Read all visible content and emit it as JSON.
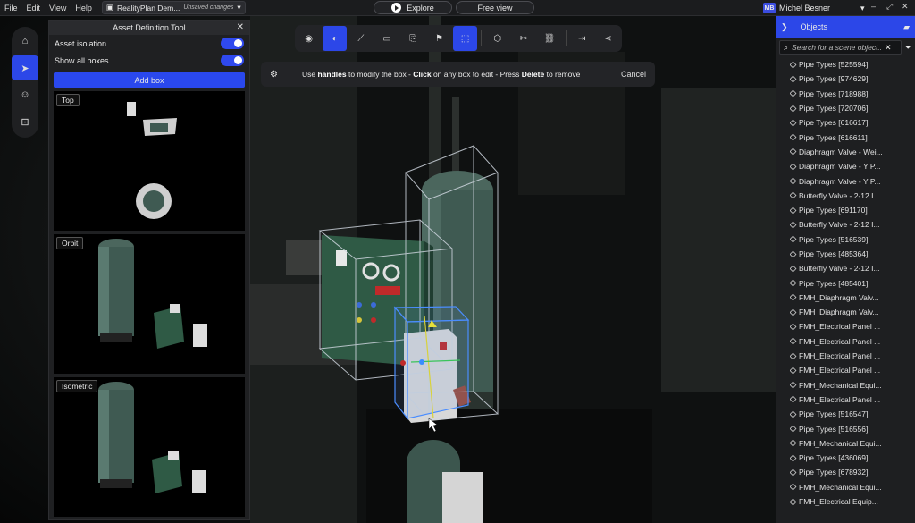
{
  "menubar": {
    "items": [
      "File",
      "Edit",
      "View",
      "Help"
    ],
    "doc_title": "RealityPlan Dem...",
    "doc_status": "Unsaved changes",
    "modes": [
      "Explore",
      "Free view"
    ],
    "user_initials": "MB",
    "user_name": "Michel Besner"
  },
  "asset_panel": {
    "title": "Asset Definition Tool",
    "asset_isolation": "Asset isolation",
    "show_all_boxes": "Show all boxes",
    "add_box": "Add box",
    "views": [
      "Top",
      "Orbit",
      "Isometric"
    ]
  },
  "hint": {
    "p1": "Use ",
    "b1": "handles",
    "p2": " to modify the box - ",
    "b2": "Click",
    "p3": " on any box to edit - Press ",
    "b3": "Delete",
    "p4": " to remove",
    "cancel": "Cancel"
  },
  "objects_panel": {
    "title": "Objects",
    "search_placeholder": "Search for a scene object...",
    "items": [
      "Pipe Types [525594]",
      "Pipe Types [974629]",
      "Pipe Types [718988]",
      "Pipe Types [720706]",
      "Pipe Types [616617]",
      "Pipe Types [616611]",
      "Diaphragm Valve - Wei...",
      "Diaphragm Valve - Y P...",
      "Diaphragm Valve - Y P...",
      "Butterfly Valve - 2-12 I...",
      "Pipe Types [691170]",
      "Butterfly Valve - 2-12 I...",
      "Pipe Types [516539]",
      "Pipe Types [485364]",
      "Butterfly Valve - 2-12 I...",
      "Pipe Types [485401]",
      "FMH_Diaphragm Valv...",
      "FMH_Diaphragm Valv...",
      "FMH_Electrical Panel ...",
      "FMH_Electrical Panel ...",
      "FMH_Electrical Panel ...",
      "FMH_Electrical Panel ...",
      "FMH_Mechanical Equi...",
      "FMH_Electrical Panel ...",
      "Pipe Types [516547]",
      "Pipe Types [516556]",
      "FMH_Mechanical Equi...",
      "Pipe Types [436069]",
      "Pipe Types [678932]",
      "FMH_Mechanical Equi...",
      "FMH_Electrical Equip..."
    ]
  },
  "colors": {
    "accent": "#2c47e8",
    "panel": "#1f2022",
    "tank": "#3f5a52",
    "panel_green": "#2f5a45"
  }
}
